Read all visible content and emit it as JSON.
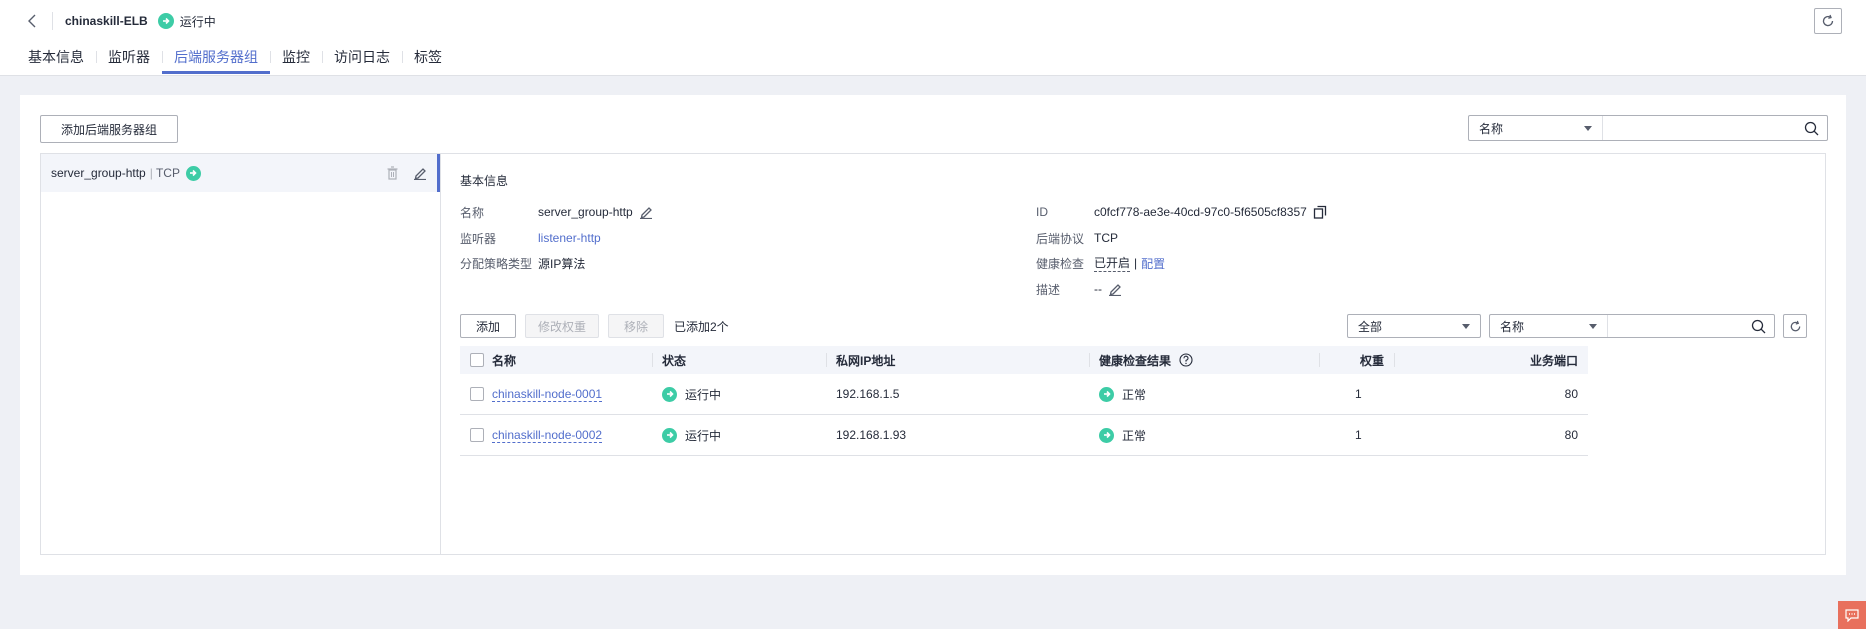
{
  "header": {
    "elb_name": "chinaskill-ELB",
    "status": "运行中"
  },
  "tabs": [
    {
      "label": "基本信息"
    },
    {
      "label": "监听器"
    },
    {
      "label": "后端服务器组",
      "active": true
    },
    {
      "label": "监控"
    },
    {
      "label": "访问日志"
    },
    {
      "label": "标签"
    }
  ],
  "toolbar": {
    "add_group_label": "添加后端服务器组",
    "search_field": "名称",
    "search_placeholder": ""
  },
  "group": {
    "name": "server_group-http",
    "separator": "|",
    "protocol": "TCP"
  },
  "basic_info": {
    "title": "基本信息",
    "name_label": "名称",
    "name_value": "server_group-http",
    "listener_label": "监听器",
    "listener_value": "listener-http",
    "algo_label": "分配策略类型",
    "algo_value": "源IP算法",
    "id_label": "ID",
    "id_value": "c0fcf778-ae3e-40cd-97c0-5f6505cf8357",
    "backend_proto_label": "后端协议",
    "backend_proto_value": "TCP",
    "health_label": "健康检查",
    "health_value": "已开启",
    "health_sep": "|",
    "health_config": "配置",
    "desc_label": "描述",
    "desc_value": "--"
  },
  "members_toolbar": {
    "add_label": "添加",
    "modify_weight_label": "修改权重",
    "remove_label": "移除",
    "added_count": "已添加2个",
    "filter_all": "全部",
    "filter_field": "名称"
  },
  "table": {
    "headers": {
      "name": "名称",
      "status": "状态",
      "ip": "私网IP地址",
      "health": "健康检查结果",
      "weight": "权重",
      "port": "业务端口"
    },
    "rows": [
      {
        "name": "chinaskill-node-0001",
        "status": "运行中",
        "ip": "192.168.1.5",
        "health": "正常",
        "weight": "1",
        "port": "80"
      },
      {
        "name": "chinaskill-node-0002",
        "status": "运行中",
        "ip": "192.168.1.93",
        "health": "正常",
        "weight": "1",
        "port": "80"
      }
    ]
  },
  "colors": {
    "accent": "#526ecc",
    "success": "#3dcca6",
    "feedback": "#e8705d"
  }
}
